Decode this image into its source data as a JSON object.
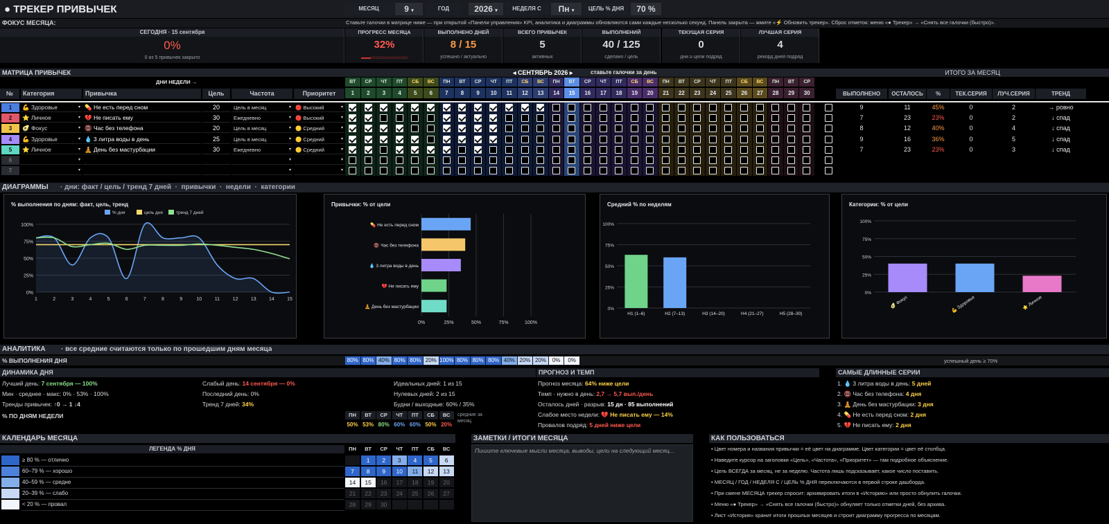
{
  "top": {
    "title": "● ТРЕКЕР ПРИВЫЧЕК",
    "month_label": "МЕСЯЦ",
    "month_value": "9",
    "year_label": "ГОД",
    "year_value": "2026",
    "week_label": "НЕДЕЛЯ С",
    "week_value": "Пн",
    "goal_label": "ЦЕЛЬ % ДНЯ",
    "goal_value": "70 %"
  },
  "focus": {
    "label": "ФОКУС МЕСЯЦА:",
    "hint": "Ставьте галочки в матрице ниже — при открытой «Панели управления» KPI, аналитика и диаграммы обновляются сами каждые несколько секунд. Панель закрыта — жмите «⚡ Обновить трекер». Сброс отметок: меню «● Трекер» → «Снять все галочки (быстро)».",
    "today_label": "СЕГОДНЯ · 15 сентября",
    "today_value": "0%",
    "today_sub": "0 из 5 привычек закрыто",
    "kpis": [
      {
        "label": "ПРОГРЕСС МЕСЯЦА",
        "value": "32%",
        "sub": "▬▬▭▭▭▭▭▭▭▭",
        "color": "#ff5a4f"
      },
      {
        "label": "ВЫПОЛНЕНО ДНЕЙ",
        "value": "8 / 15",
        "sub": "успешно / актуально",
        "color": "#ff9a44"
      },
      {
        "label": "ВСЕГО ПРИВЫЧЕК",
        "value": "5",
        "sub": "активных",
        "color": "#d6d9de"
      },
      {
        "label": "ВЫПОЛНЕНИЙ",
        "value": "40 / 125",
        "sub": "сделано / цель",
        "color": "#d6d9de"
      },
      {
        "label": "ТЕКУЩАЯ СЕРИЯ",
        "value": "0",
        "sub": "дни ≥ цели подряд",
        "color": "#d6d9de"
      },
      {
        "label": "ЛУЧШАЯ СЕРИЯ",
        "value": "4",
        "sub": "рекорд дней подряд",
        "color": "#d6d9de"
      }
    ]
  },
  "matrix": {
    "label": "МАТРИЦА ПРИВЫЧЕК",
    "days_of_week_label": "ДНИ НЕДЕЛИ →",
    "month_nav": "◂ СЕНТЯБРЬ 2026 ▸",
    "month_hint": "ставьте галочки за день",
    "totals_label": "ИТОГО ЗА МЕСЯЦ",
    "col_num": "№",
    "col_cat": "Категория",
    "col_habit": "Привычка",
    "col_goal": "Цель",
    "col_freq": "Частота",
    "col_prio": "Приоритет",
    "tot_cols": [
      "ВЫПОЛНЕНО",
      "ОСТАЛОСЬ",
      "%",
      "ТЕК.СЕРИЯ",
      "ЛУЧ.СЕРИЯ",
      "ТРЕНД"
    ],
    "weekdays": [
      "ВТ",
      "СР",
      "ЧТ",
      "ПТ",
      "СБ",
      "ВС",
      "ПН",
      "ВТ",
      "СР",
      "ЧТ",
      "ПТ",
      "СБ",
      "ВС",
      "ПН",
      "ВТ",
      "СР",
      "ЧТ",
      "ПТ",
      "СБ",
      "ВС",
      "ПН",
      "ВТ",
      "СР",
      "ЧТ",
      "ПТ",
      "СБ",
      "ВС",
      "ПН",
      "ВТ",
      "СР"
    ],
    "days": [
      "1",
      "2",
      "3",
      "4",
      "5",
      "6",
      "7",
      "8",
      "9",
      "10",
      "11",
      "12",
      "13",
      "14",
      "15",
      "16",
      "17",
      "18",
      "19",
      "20",
      "21",
      "22",
      "23",
      "24",
      "25",
      "26",
      "27",
      "28",
      "29",
      "30"
    ],
    "rows": [
      {
        "n": "1",
        "color": "#4a7ee0",
        "cat": "💪 Здоровье",
        "habit": "💊 Не есть перед сном",
        "goal": "20",
        "freq": "Цель в месяц",
        "prio": "🔴 Высокий",
        "done": "9",
        "left": "11",
        "pct": "45%",
        "pctc": "#ff9a44",
        "cur": "0",
        "best": "2",
        "trend": "→ ровно",
        "checks": [
          1,
          1,
          1,
          1,
          1,
          1,
          1,
          1,
          1,
          1,
          1,
          1,
          1,
          0,
          0
        ]
      },
      {
        "n": "2",
        "color": "#e2576a",
        "cat": "⭐ Личное",
        "habit": "💔 Не писать ему",
        "goal": "30",
        "freq": "Ежедневно",
        "prio": "🔴 Высокий",
        "done": "7",
        "left": "23",
        "pct": "23%",
        "pctc": "#ff5a4f",
        "cur": "0",
        "best": "2",
        "trend": "↓ спад",
        "checks": [
          1,
          1,
          0,
          0,
          0,
          0,
          1,
          1,
          1,
          1,
          0,
          0,
          0,
          0,
          0
        ]
      },
      {
        "n": "3",
        "color": "#f1c34a",
        "cat": "🥑 Фокус",
        "habit": "📵 Час без телефона",
        "goal": "20",
        "freq": "Цель в месяц",
        "prio": "🟡 Средний",
        "done": "8",
        "left": "12",
        "pct": "40%",
        "pctc": "#ff9a44",
        "cur": "0",
        "best": "4",
        "trend": "↓ спад",
        "checks": [
          1,
          1,
          1,
          1,
          0,
          0,
          1,
          1,
          1,
          1,
          0,
          0,
          0,
          0,
          0
        ]
      },
      {
        "n": "4",
        "color": "#a78bfa",
        "cat": "💪 Здоровье",
        "habit": "💧 3 литра воды в день",
        "goal": "25",
        "freq": "Цель в месяц",
        "prio": "🟡 Средний",
        "done": "9",
        "left": "16",
        "pct": "36%",
        "pctc": "#ff9a44",
        "cur": "0",
        "best": "5",
        "trend": "↓ спад",
        "checks": [
          1,
          1,
          1,
          1,
          1,
          0,
          1,
          1,
          1,
          1,
          0,
          0,
          0,
          0,
          0
        ]
      },
      {
        "n": "5",
        "color": "#5fd7c2",
        "cat": "⭐ Личное",
        "habit": "🧘 День без мастурбации",
        "goal": "30",
        "freq": "Ежедневно",
        "prio": "🟡 Средний",
        "done": "7",
        "left": "23",
        "pct": "23%",
        "pctc": "#ff5a4f",
        "cur": "0",
        "best": "3",
        "trend": "↓ спад",
        "checks": [
          1,
          1,
          0,
          1,
          1,
          1,
          1,
          0,
          1,
          0,
          0,
          0,
          0,
          0,
          0
        ]
      },
      {
        "n": "6",
        "color": "#2a2d33",
        "cat": "",
        "habit": "",
        "goal": "",
        "freq": "",
        "prio": "",
        "done": "",
        "left": "",
        "pct": "",
        "pctc": "#fff",
        "cur": "",
        "best": "",
        "trend": "",
        "checks": [
          0,
          0,
          0,
          0,
          0,
          0,
          0,
          0,
          0,
          0,
          0,
          0,
          0,
          0,
          0
        ]
      },
      {
        "n": "7",
        "color": "#2a2d33",
        "cat": "",
        "habit": "",
        "goal": "",
        "freq": "",
        "prio": "",
        "done": "",
        "left": "",
        "pct": "",
        "pctc": "#fff",
        "cur": "",
        "best": "",
        "trend": "",
        "checks": [
          0,
          0,
          0,
          0,
          0,
          0,
          0,
          0,
          0,
          0,
          0,
          0,
          0,
          0,
          0
        ]
      }
    ]
  },
  "charts_bar": {
    "label": "ДИАГРАММЫ",
    "links": [
      "дни: факт / цель / тренд 7 дней",
      "привычки",
      "недели",
      "категории"
    ]
  },
  "chart_data": [
    {
      "type": "line",
      "title": "% выполнения по дням: факт, цель, тренд",
      "x": [
        1,
        2,
        3,
        4,
        5,
        6,
        7,
        8,
        9,
        10,
        11,
        12,
        13,
        14,
        15
      ],
      "series": [
        {
          "name": "% дня",
          "values": [
            80,
            80,
            40,
            80,
            80,
            20,
            100,
            80,
            80,
            80,
            40,
            20,
            20,
            0,
            0
          ],
          "color": "#6aa5f5"
        },
        {
          "name": "цель дня",
          "values": [
            70,
            70,
            70,
            70,
            70,
            70,
            70,
            70,
            70,
            70,
            70,
            70,
            70,
            70,
            70
          ],
          "color": "#f5d76e"
        },
        {
          "name": "тренд 7 дней",
          "values": [
            80,
            80,
            67,
            70,
            72,
            63,
            69,
            69,
            69,
            71,
            69,
            66,
            63,
            57,
            49
          ],
          "color": "#8fe08f"
        }
      ],
      "yticks": [
        "0%",
        "25%",
        "50%",
        "75%",
        "100%"
      ],
      "ylim": [
        0,
        100
      ]
    },
    {
      "type": "bar",
      "title": "Привычки: % от цели",
      "categories": [
        "💊 Не есть перед сном",
        "📵 Час без телефона",
        "💧 3 литра воды в день",
        "💔 Не писать ему",
        "🧘 День без мастурбации"
      ],
      "values": [
        45,
        40,
        36,
        23,
        23
      ],
      "colors": [
        "#6aa5f5",
        "#f5c76a",
        "#a78bfa",
        "#6fd38a",
        "#6fdcc8"
      ],
      "xticks": [
        "0%",
        "25%",
        "50%",
        "75%",
        "100%"
      ],
      "xlim": [
        0,
        100
      ]
    },
    {
      "type": "bar",
      "title": "Средний % по неделям",
      "categories": [
        "Н1 (1–6)",
        "Н2 (7–13)",
        "Н3 (14–20)",
        "Н4 (21–27)",
        "Н5 (28–30)"
      ],
      "values": [
        63,
        60,
        0,
        0,
        0
      ],
      "colors": [
        "#6fd38a",
        "#6aa5f5",
        "#6aa5f5",
        "#6aa5f5",
        "#6aa5f5"
      ],
      "yticks": [
        "0%",
        "25%",
        "50%",
        "75%",
        "100%"
      ],
      "ylim": [
        0,
        100
      ]
    },
    {
      "type": "bar",
      "title": "Категории: % от цели",
      "categories": [
        "🥑 Фокус",
        "💪 Здоровье",
        "⭐ Личное"
      ],
      "values": [
        40,
        40,
        23
      ],
      "colors": [
        "#a78bfa",
        "#6aa5f5",
        "#e879c9"
      ],
      "yticks": [
        "0%",
        "25%",
        "50%",
        "75%",
        "100%"
      ],
      "ylim": [
        0,
        100
      ]
    }
  ],
  "analytics": {
    "label": "АНАЛИТИКА",
    "sub": "все средние считаются только по прошедшим дням месяца",
    "pct_label": "% ВЫПОЛНЕНИЯ ДНЯ",
    "day_pcts": [
      "80%",
      "80%",
      "40%",
      "80%",
      "80%",
      "20%",
      "100%",
      "80%",
      "80%",
      "80%",
      "40%",
      "20%",
      "20%",
      "0%",
      "0%"
    ],
    "success_hint": "успешный день ≥ 70%",
    "dyn_label": "ДИНАМИКА ДНЯ",
    "best_day_l": "Лучший день:",
    "best_day_v": "7 сентября — 100%",
    "weak_day_l": "Слабый день:",
    "weak_day_v": "14 сентября — 0%",
    "ideal_l": "Идеальных дней:",
    "ideal_v": "1 из 15",
    "minmax_l": "Мин · среднее · макс:",
    "minmax_v": "0% · 53% · 100%",
    "last_l": "Последний день:",
    "last_v": "0%",
    "zero_l": "Нулевых дней:",
    "zero_v": "2 из 15",
    "trends_l": "Тренды привычек:",
    "trends_v": "↑0 → 1 ↓4",
    "trend7_l": "Тренд 7 дней:",
    "trend7_v": "34%",
    "weekend_l": "Будни / выходные:",
    "weekend_v": "60% / 35%",
    "wk_label": "% ПО ДНЯМ НЕДЕЛИ",
    "wk_days": [
      "ПН",
      "ВТ",
      "СР",
      "ЧТ",
      "ПТ",
      "СБ",
      "ВС"
    ],
    "wk_vals": [
      "50%",
      "53%",
      "80%",
      "60%",
      "60%",
      "50%",
      "20%"
    ],
    "wk_note": "средние за месяц",
    "forecast_label": "ПРОГНОЗ И ТЕМП",
    "fc1_l": "Прогноз месяца:",
    "fc1_v": "64% ниже цели",
    "fc2_l": "Темп · нужно в день:",
    "fc2_v": "2,7 → 5,7 вып./день",
    "fc3_l": "Осталось дней · разрыв:",
    "fc3_v": "15 дн · 85 выполнений",
    "fc4_l": "Слабое место недели:",
    "fc4_v": "💔 Не писать ему — 14%",
    "fc5_l": "Провалов подряд:",
    "fc5_v": "5 дней ниже цели",
    "streaks_label": "САМЫЕ ДЛИННЫЕ СЕРИИ",
    "streaks": [
      {
        "t": "1. 💧 3 литра воды в день:",
        "v": "5 дней"
      },
      {
        "t": "2. 📵 Час без телефона:",
        "v": "4 дня"
      },
      {
        "t": "3. 🧘 День без мастурбации:",
        "v": "3 дня"
      },
      {
        "t": "4. 💊 Не есть перед сном:",
        "v": "2 дня"
      },
      {
        "t": "5. 💔 Не писать ему:",
        "v": "2 дня"
      }
    ]
  },
  "calendar": {
    "label": "КАЛЕНДАРЬ МЕСЯЦА",
    "legend_label": "ЛЕГЕНДА % ДНЯ",
    "legend": [
      {
        "t": "≥ 80 % — отлично",
        "c": "#2f66c9"
      },
      {
        "t": "60–79 % — хорошо",
        "c": "#4d82db"
      },
      {
        "t": "40–59 % — средне",
        "c": "#84aeea"
      },
      {
        "t": "20–39 % — слабо",
        "c": "#c7d9f5"
      },
      {
        "t": "< 20 % — провал",
        "c": "#f2f5fb"
      }
    ],
    "dow": [
      "ПН",
      "ВТ",
      "СР",
      "ЧТ",
      "ПТ",
      "СБ",
      "ВС"
    ],
    "weeks": [
      [
        "",
        "1",
        "2",
        "3",
        "4",
        "5",
        "6"
      ],
      [
        "7",
        "8",
        "9",
        "10",
        "11",
        "12",
        "13"
      ],
      [
        "14",
        "15",
        "16",
        "17",
        "18",
        "19",
        "20"
      ],
      [
        "21",
        "22",
        "23",
        "24",
        "25",
        "26",
        "27"
      ],
      [
        "28",
        "29",
        "30",
        "",
        "",
        "",
        ""
      ]
    ]
  },
  "notes": {
    "label": "ЗАМЕТКИ / ИТОГИ МЕСЯЦА",
    "placeholder": "Пишите ключевые мысли месяца, выводы, цели на следующий месяц..."
  },
  "howto": {
    "label": "КАК ПОЛЬЗОВАТЬСЯ",
    "items": [
      "• Цвет номера и названия привычки = её цвет на диаграмме. Цвет категории = цвет её столбца.",
      "• Наведите курсор на заголовки «Цель», «Частота», «Приоритет» — там подробное объяснение.",
      "• Цель ВСЕГДА за месяц, не за неделю. Частота лишь подсказывает, какое число поставить.",
      "• МЕСЯЦ / ГОД / НЕДЕЛЯ С / ЦЕЛЬ % ДНЯ переключаются в первой строке дашборда.",
      "• При смене МЕСЯЦА трекер спросит: архивировать итоги в «Историю» или просто обнулить галочки.",
      "• Меню «● Трекер» → «Снять все галочки (быстро)» обнуляет только отметки дней, без архива.",
      "• Лист «История» хранит итоги прошлых месяцев и строит диаграмму прогресса по месяцам."
    ]
  }
}
